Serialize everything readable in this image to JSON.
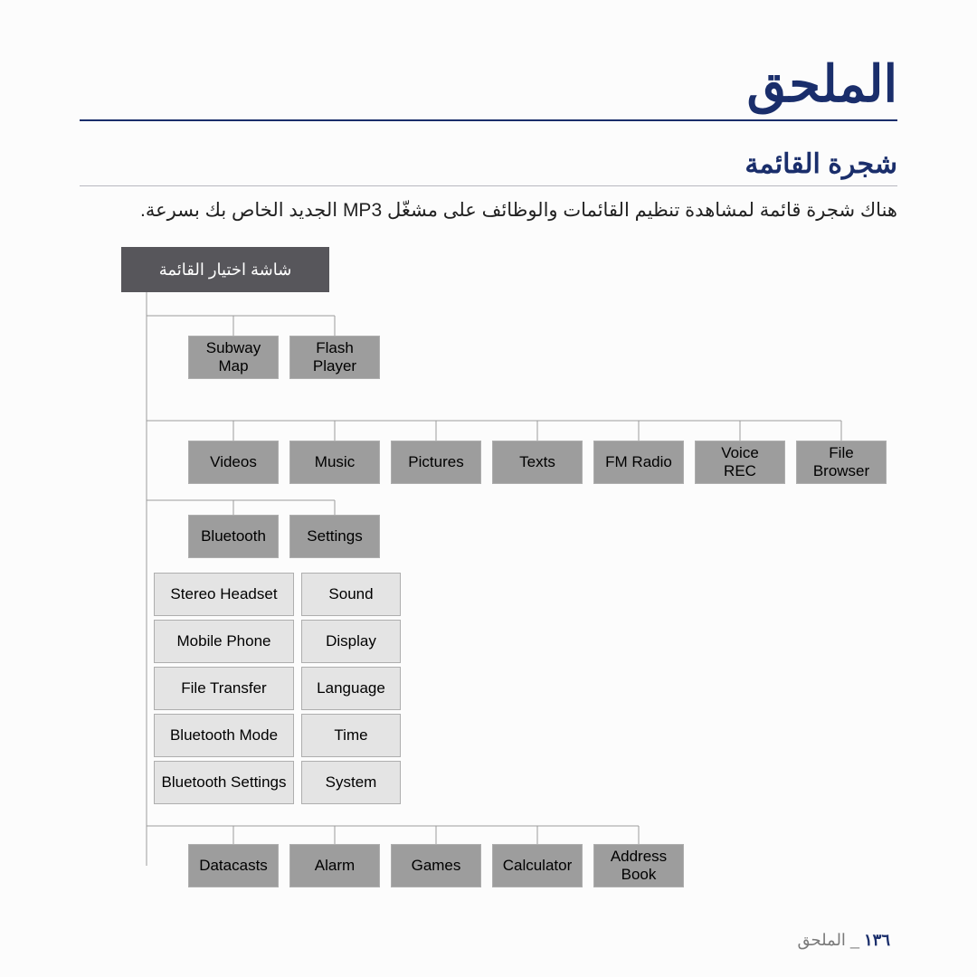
{
  "title": "الملحق",
  "section_heading": "شجرة القائمة",
  "description": "هناك شجرة قائمة لمشاهدة تنظيم القائمات والوظائف على مشغّل MP3 الجديد الخاص بك بسرعة.",
  "root_label": "شاشة اختيار القائمة",
  "row1": {
    "subway": "Subway\nMap",
    "flash": "Flash\nPlayer"
  },
  "row2": {
    "videos": "Videos",
    "music": "Music",
    "pictures": "Pictures",
    "texts": "Texts",
    "fmradio": "FM Radio",
    "voicerec": "Voice\nREC",
    "filebr": "File\nBrowser"
  },
  "row3": {
    "bluetooth": "Bluetooth",
    "settings": "Settings"
  },
  "bluetooth_sub": {
    "a": "Stereo Headset",
    "b": "Mobile Phone",
    "c": "File Transfer",
    "d": "Bluetooth Mode",
    "e": "Bluetooth Settings"
  },
  "settings_sub": {
    "a": "Sound",
    "b": "Display",
    "c": "Language",
    "d": "Time",
    "e": "System"
  },
  "row5": {
    "datacasts": "Datacasts",
    "alarm": "Alarm",
    "games": "Games",
    "calculator": "Calculator",
    "address": "Address\nBook"
  },
  "footer": {
    "section": "الملحق",
    "page": "١٣٦",
    "separator": "_"
  }
}
